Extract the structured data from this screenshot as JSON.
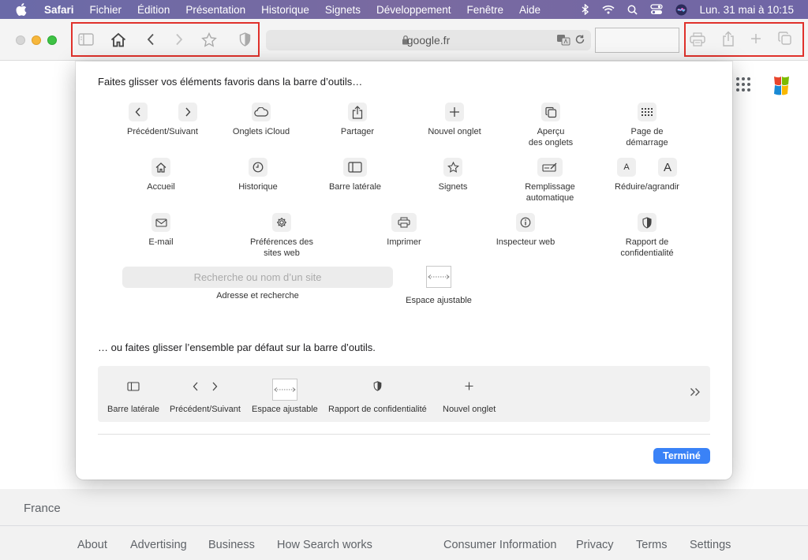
{
  "menubar": {
    "app": "Safari",
    "items": [
      "Fichier",
      "Édition",
      "Présentation",
      "Historique",
      "Signets",
      "Développement",
      "Fenêtre",
      "Aide"
    ],
    "clock": "Lun. 31 mai à  10:15"
  },
  "toolbar": {
    "url": "google.fr"
  },
  "sheet": {
    "heading": "Faites glisser vos éléments favoris dans la barre d’outils…",
    "items": {
      "prev_next": "Précédent/Suivant",
      "icloud_tabs": "Onglets iCloud",
      "share": "Partager",
      "new_tab": "Nouvel onglet",
      "tab_overview_1": "Aperçu",
      "tab_overview_2": "des onglets",
      "start_page_1": "Page de",
      "start_page_2": "démarrage",
      "home": "Accueil",
      "history": "Historique",
      "sidebar": "Barre latérale",
      "bookmarks": "Signets",
      "autofill_1": "Remplissage",
      "autofill_2": "automatique",
      "zoom": "Réduire/agrandir",
      "zoom_small": "A",
      "zoom_large": "A",
      "email": "E-mail",
      "site_prefs_1": "Préférences des",
      "site_prefs_2": "sites web",
      "print": "Imprimer",
      "web_inspector": "Inspecteur web",
      "privacy_1": "Rapport de",
      "privacy_2": "confidentialité",
      "search_placeholder": "Recherche ou nom d’un site",
      "address_search": "Adresse et recherche",
      "flexible_space": "Espace ajustable"
    },
    "heading2": "… ou faites glisser l’ensemble par défaut sur la barre d’outils.",
    "default_set": [
      "Barre latérale",
      "Précédent/Suivant",
      "Espace ajustable",
      "Rapport de confidentialité",
      "Nouvel onglet"
    ],
    "done": "Terminé"
  },
  "page": {
    "country": "France",
    "footer_links": [
      "About",
      "Advertising",
      "Business",
      "How Search works",
      "Consumer Information",
      "Privacy",
      "Terms",
      "Settings"
    ]
  },
  "colors": {
    "highlight": "#e0312b",
    "done_button": "#3a82f7"
  }
}
